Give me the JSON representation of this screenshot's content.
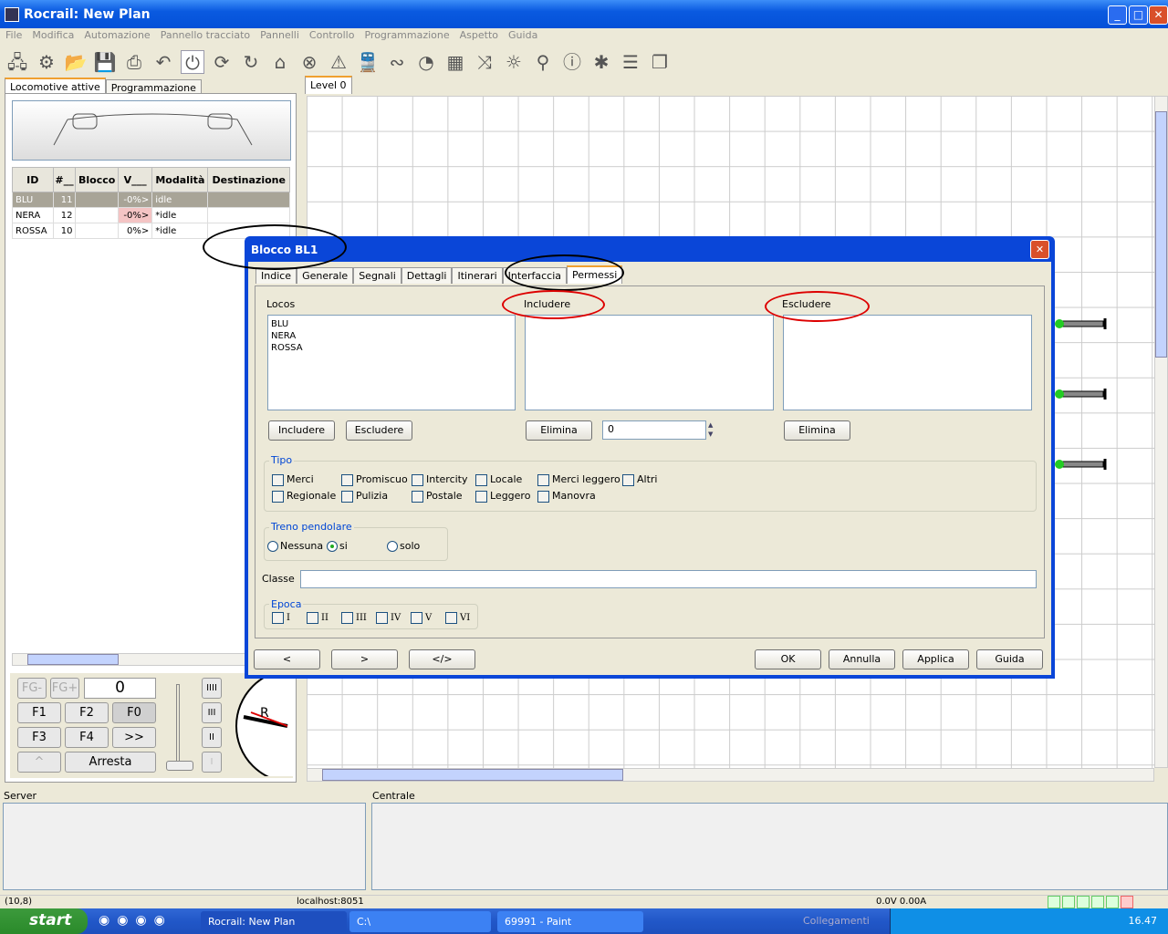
{
  "window": {
    "title": "Rocrail: New Plan"
  },
  "menu": [
    "File",
    "Modifica",
    "Automazione",
    "Pannello tracciato",
    "Pannelli",
    "Controllo",
    "Programmazione",
    "Aspetto",
    "Guida"
  ],
  "toolbar": [
    "network-icon",
    "settings-icon",
    "open-icon",
    "save-icon",
    "print-icon",
    "undo-icon",
    "power-icon",
    "sync-icon",
    "reset-icon",
    "home-icon",
    "stop-icon",
    "warning-icon",
    "train-icon",
    "locos-icon",
    "speedometer-icon",
    "switchboard-icon",
    "shuffle-icon",
    "light-icon",
    "search-icon",
    "info-icon",
    "bug-icon",
    "list-icon",
    "copy-icon"
  ],
  "left": {
    "tabs": [
      "Locomotive attive",
      "Programmazione"
    ],
    "columns": [
      "ID",
      "#__",
      "Blocco",
      "V___",
      "Modalità",
      "Destinazione"
    ],
    "rows": [
      [
        "BLU",
        "11",
        "",
        "-0%>",
        "idle",
        ""
      ],
      [
        "NERA",
        "12",
        "",
        "-0%>",
        "*idle",
        ""
      ],
      [
        "ROSSA",
        "10",
        "",
        "0%>",
        "*idle",
        ""
      ]
    ],
    "throttle": {
      "fg_minus": "FG-",
      "fg_plus": "FG+",
      "speed": "0",
      "f1": "F1",
      "f2": "F2",
      "f0": "F0",
      "f3": "F3",
      "f4": "F4",
      "more": ">>",
      "up": "^",
      "stop": "Arresta",
      "steps": [
        "IIII",
        "III",
        "II",
        "I"
      ],
      "clock_logo": "Rocrail"
    }
  },
  "plan": {
    "tab": "Level 0"
  },
  "dialog": {
    "title": "Blocco BL1",
    "tabs": [
      "Indice",
      "Generale",
      "Segnali",
      "Dettagli",
      "Itinerari",
      "Interfaccia",
      "Permessi"
    ],
    "locos_label": "Locos",
    "locos": [
      "BLU",
      "NERA",
      "ROSSA"
    ],
    "include_label": "Includere",
    "exclude_label": "Escludere",
    "include_btn": "Includere",
    "exclude_btn": "Escludere",
    "delete_btn": "Elimina",
    "spinner_value": "0",
    "tipo_label": "Tipo",
    "tipo": [
      "Merci",
      "Promiscuo",
      "Intercity",
      "Locale",
      "Merci leggero",
      "Altri",
      "Regionale",
      "Pulizia",
      "Postale",
      "Leggero",
      "Manovra"
    ],
    "commuter_label": "Treno pendolare",
    "commuter": [
      "Nessuna",
      "si",
      "solo"
    ],
    "commuter_selected": "si",
    "classe_label": "Classe",
    "classe_value": "",
    "epoca_label": "Epoca",
    "epoca": [
      "I",
      "II",
      "III",
      "IV",
      "V",
      "VI"
    ],
    "buttons": {
      "prev": "<",
      "next": ">",
      "xml": "</>",
      "ok": "OK",
      "cancel": "Annulla",
      "apply": "Applica",
      "help": "Guida"
    }
  },
  "bottom": {
    "server_label": "Server",
    "centrale_label": "Centrale"
  },
  "status": {
    "coords": "(10,8)",
    "host": "localhost:8051",
    "power": "0.0V 0.00A"
  },
  "taskbar": {
    "start": "start",
    "tasks": [
      "Rocrail: New Plan",
      "C:\\",
      "69991 - Paint"
    ],
    "links": "Collegamenti",
    "clock": "16.47"
  }
}
